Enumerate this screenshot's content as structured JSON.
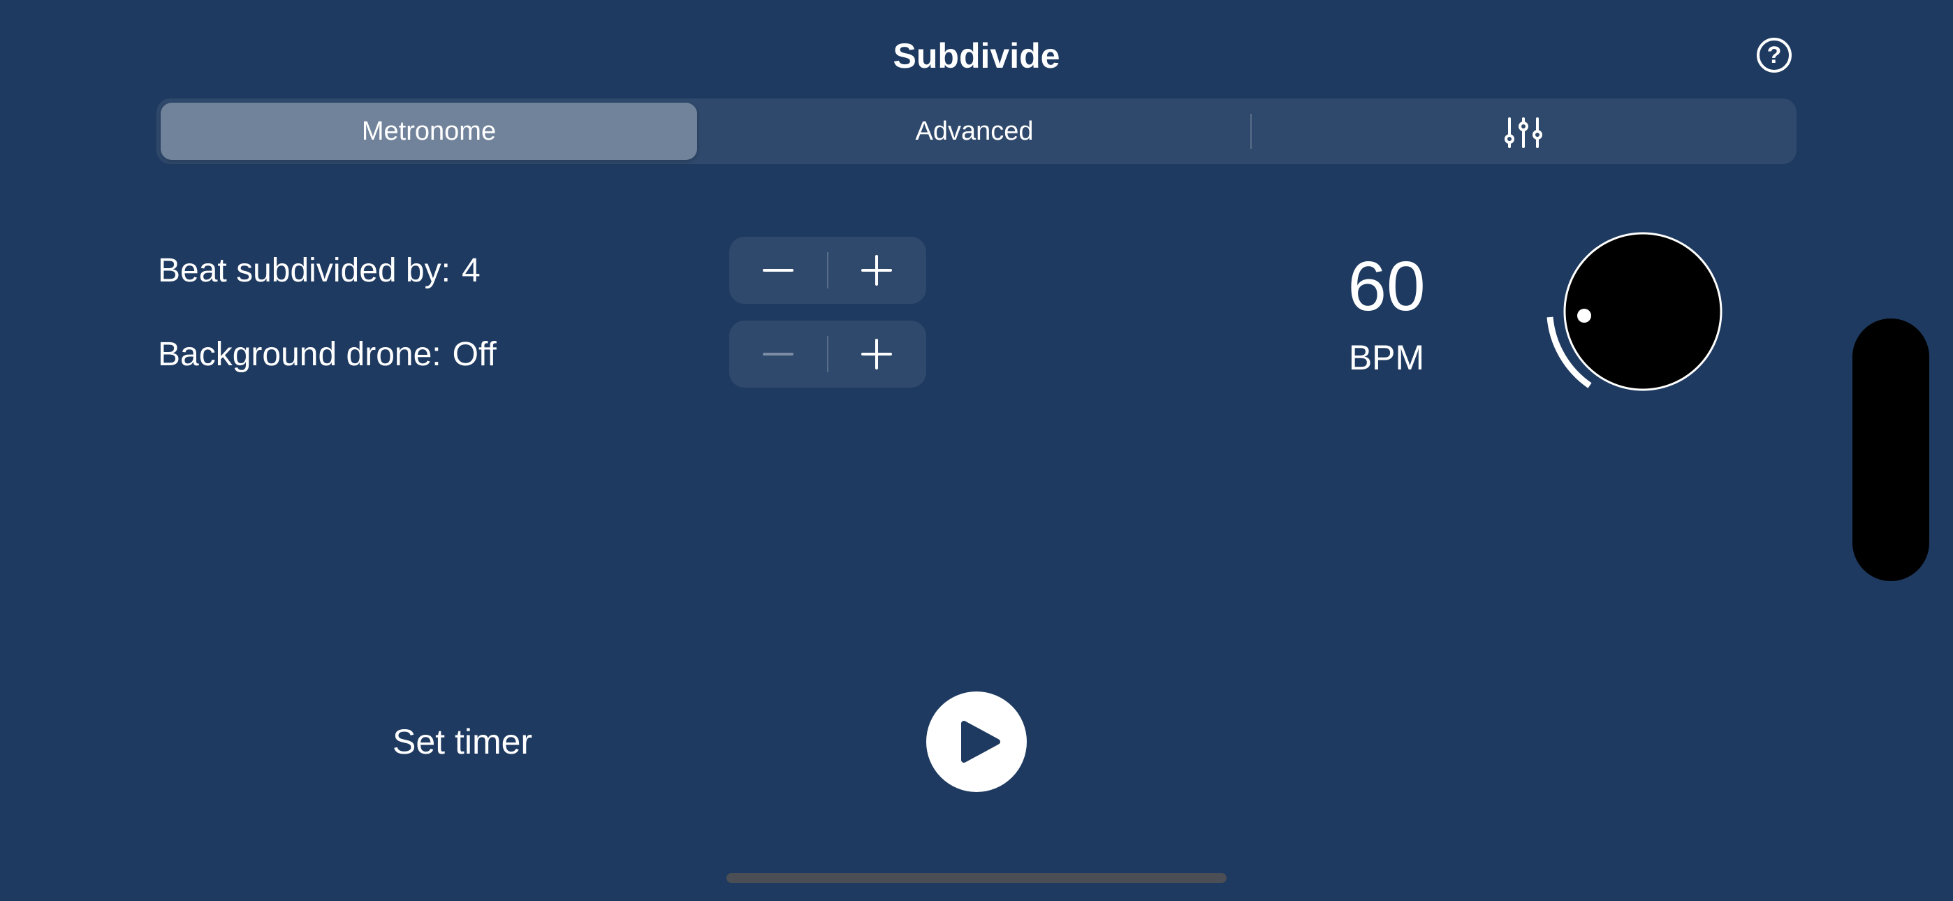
{
  "header": {
    "title": "Subdivide",
    "help_symbol": "?"
  },
  "tabs": [
    {
      "label": "Metronome",
      "selected": true
    },
    {
      "label": "Advanced",
      "selected": false
    },
    {
      "label": "",
      "icon": "sliders-icon",
      "selected": false
    }
  ],
  "settings": {
    "subdivision": {
      "label": "Beat subdivided by:",
      "value": "4"
    },
    "drone": {
      "label": "Background drone:",
      "value": "Off"
    }
  },
  "tempo": {
    "bpm": "60",
    "unit": "BPM"
  },
  "timer": {
    "label": "Set timer"
  },
  "icons": {
    "help": "question-circle-icon",
    "settings": "sliders-icon",
    "minus": "minus-icon",
    "plus": "plus-icon",
    "play": "play-icon"
  },
  "colors": {
    "background": "#1e3a60",
    "foreground": "#ffffff",
    "knob": "#000000",
    "disabled": "#7b8ca4"
  }
}
